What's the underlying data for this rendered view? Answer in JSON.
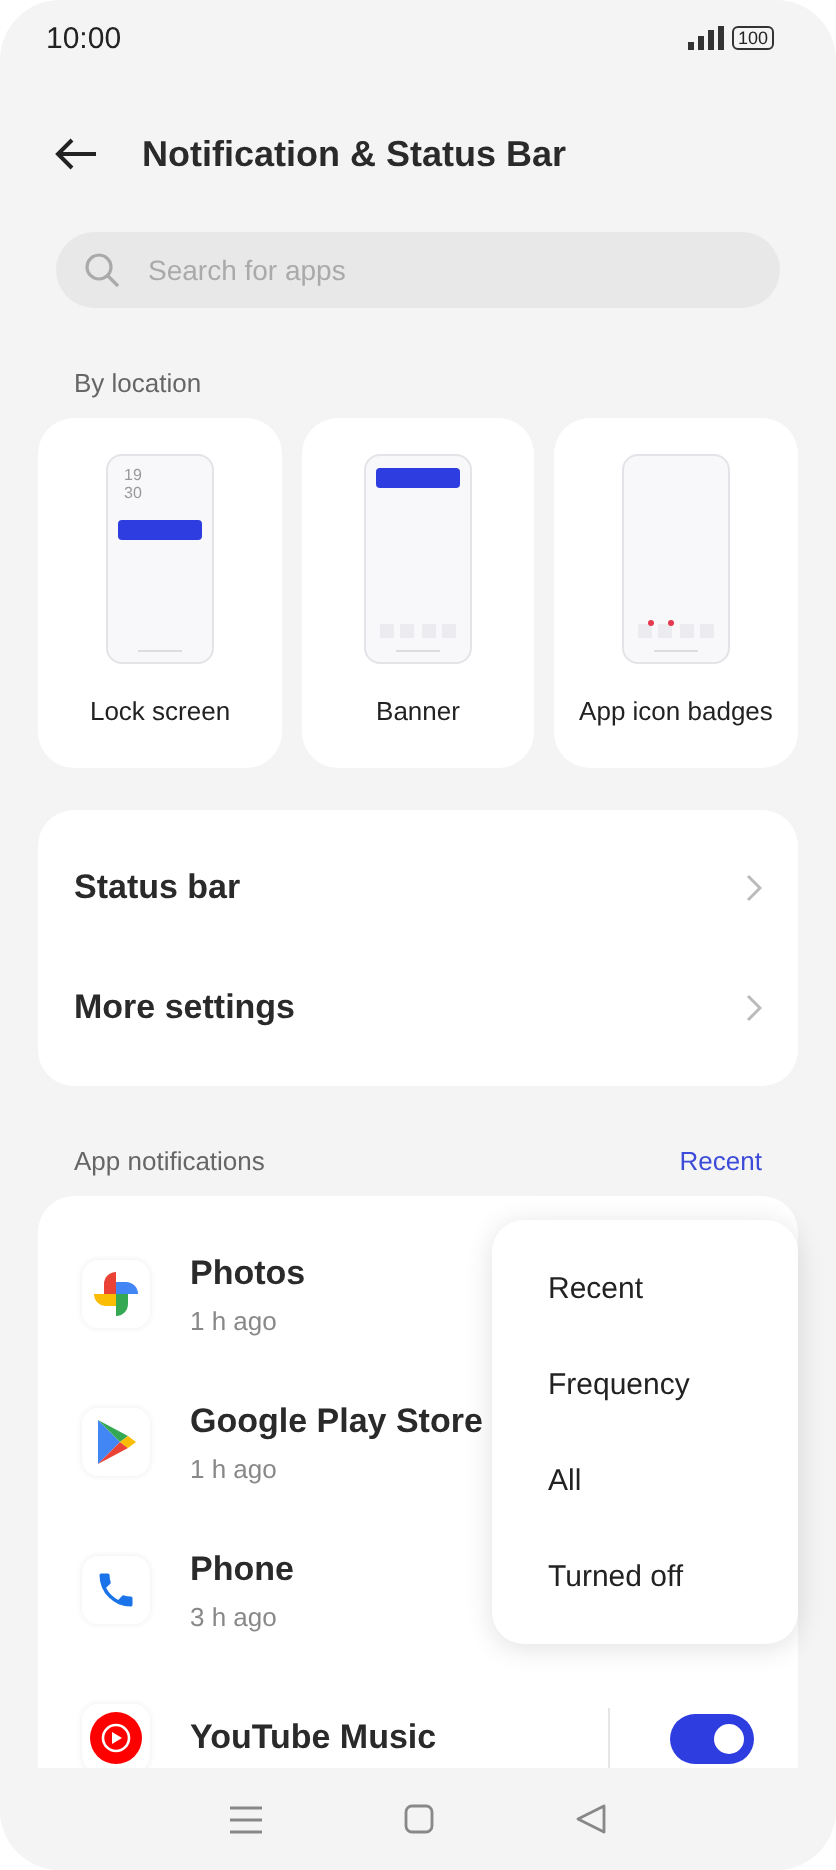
{
  "status_bar": {
    "time": "10:00",
    "battery": "100"
  },
  "header": {
    "title": "Notification & Status Bar"
  },
  "search": {
    "placeholder": "Search for apps"
  },
  "by_location": {
    "heading": "By location",
    "options": [
      {
        "kind": "lock",
        "label": "Lock screen",
        "clock": [
          "19",
          "30"
        ]
      },
      {
        "kind": "banner",
        "label": "Banner"
      },
      {
        "kind": "badges",
        "label": "App icon badges"
      }
    ]
  },
  "settings": [
    {
      "label": "Status bar"
    },
    {
      "label": "More settings"
    }
  ],
  "app_notifications": {
    "heading": "App notifications",
    "sort": "Recent",
    "apps": [
      {
        "kind": "photos",
        "name": "Photos",
        "time": "1 h ago"
      },
      {
        "kind": "play",
        "name": "Google Play Store",
        "time": "1 h ago"
      },
      {
        "kind": "phone",
        "name": "Phone",
        "time": "3 h ago"
      },
      {
        "kind": "music",
        "name": "YouTube Music",
        "on": true
      }
    ]
  },
  "sort_menu": [
    {
      "label": "Recent"
    },
    {
      "label": "Frequency"
    },
    {
      "label": "All"
    },
    {
      "label": "Turned off"
    }
  ]
}
